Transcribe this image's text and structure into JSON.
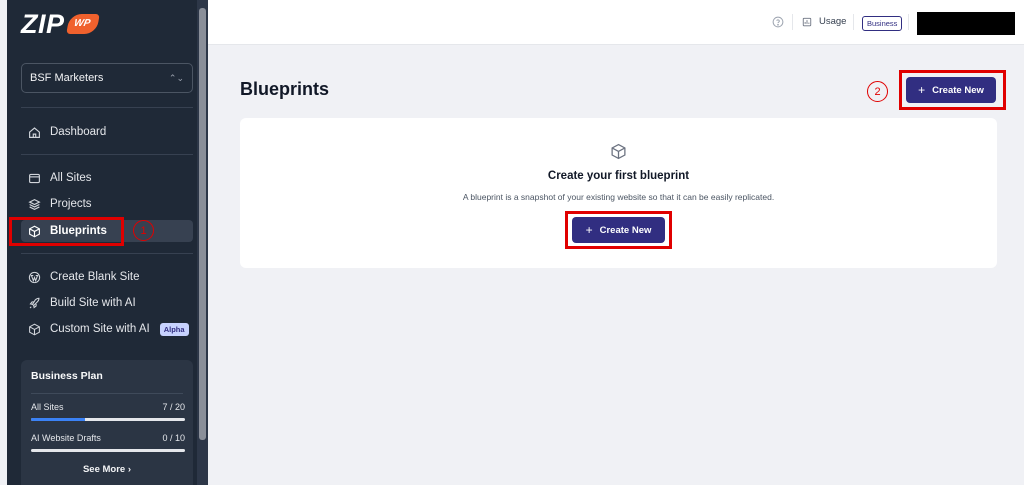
{
  "app": {
    "logo_text": "ZIP",
    "logo_badge": "WP"
  },
  "sidebar": {
    "org_name": "BSF Marketers",
    "org_chevron": "⌃⌄",
    "items": [
      {
        "label": "Dashboard",
        "icon": "home-icon"
      },
      {
        "label": "All Sites",
        "icon": "window-icon"
      },
      {
        "label": "Projects",
        "icon": "layers-icon"
      },
      {
        "label": "Blueprints",
        "icon": "cube-icon",
        "active": true
      },
      {
        "label": "Create Blank Site",
        "icon": "wordpress-icon"
      },
      {
        "label": "Build Site with AI",
        "icon": "rocket-icon"
      },
      {
        "label": "Custom Site with AI",
        "icon": "cube-sparkle-icon",
        "badge": "Alpha"
      }
    ],
    "plan": {
      "title": "Business Plan",
      "rows": [
        {
          "label": "All Sites",
          "value": "7 / 20",
          "progress": 0.35
        },
        {
          "label": "AI Website Drafts",
          "value": "0 / 10",
          "progress": 0.0
        }
      ],
      "see_more": "See More ›"
    }
  },
  "header": {
    "usage_label": "Usage",
    "plan_badge": "Business"
  },
  "main": {
    "title": "Blueprints",
    "create_new_label": "Create New",
    "empty_title": "Create your first blueprint",
    "empty_description": "A blueprint is a snapshot of your existing website so that it can be easily replicated."
  },
  "annotations": {
    "step1": "1",
    "step2": "2",
    "highlight_color": "#e00000"
  },
  "colors": {
    "sidebar_bg": "#1f2937",
    "primary": "#312e81",
    "logo_accent": "#f0612d"
  }
}
